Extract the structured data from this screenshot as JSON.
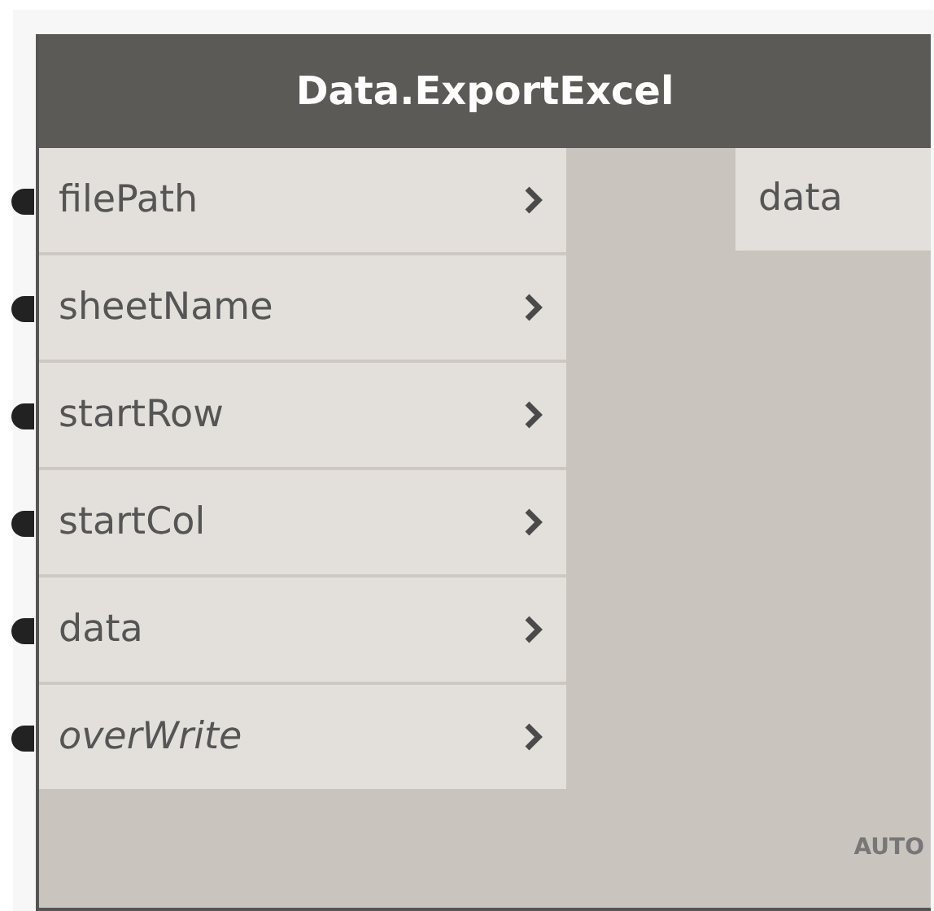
{
  "node": {
    "title": "Data.ExportExcel",
    "inputs": [
      {
        "name": "filePath",
        "optional": false
      },
      {
        "name": "sheetName",
        "optional": false
      },
      {
        "name": "startRow",
        "optional": false
      },
      {
        "name": "startCol",
        "optional": false
      },
      {
        "name": "data",
        "optional": false
      },
      {
        "name": "overWrite",
        "optional": true
      }
    ],
    "outputs": [
      {
        "name": "data"
      }
    ],
    "lacing": "AUTO"
  }
}
